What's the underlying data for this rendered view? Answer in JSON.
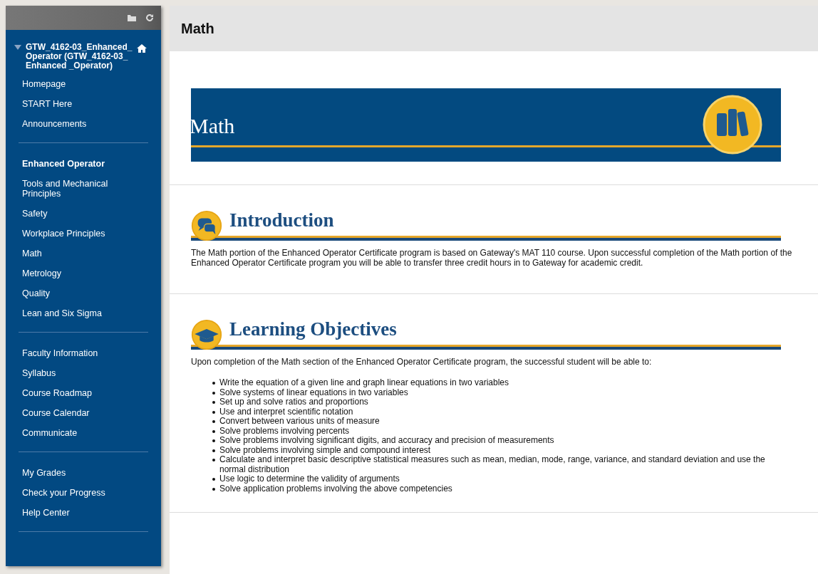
{
  "sidebar": {
    "course": {
      "title": "GTW_4162-03_Enhanced_Operator (GTW_4162-03_Enhanced _Operator)",
      "expanded": true
    },
    "groups": [
      {
        "items": [
          {
            "label": "Homepage",
            "kind": "link"
          },
          {
            "label": "START Here",
            "kind": "link"
          },
          {
            "label": "Announcements",
            "kind": "link"
          }
        ]
      },
      {
        "items": [
          {
            "label": "Enhanced Operator",
            "kind": "heading"
          },
          {
            "label": "Tools and Mechanical Principles",
            "kind": "link"
          },
          {
            "label": "Safety",
            "kind": "link"
          },
          {
            "label": "Workplace Principles",
            "kind": "link"
          },
          {
            "label": "Math",
            "kind": "link"
          },
          {
            "label": "Metrology",
            "kind": "link"
          },
          {
            "label": "Quality",
            "kind": "link"
          },
          {
            "label": "Lean and Six Sigma",
            "kind": "link"
          }
        ]
      },
      {
        "items": [
          {
            "label": "Faculty Information",
            "kind": "link"
          },
          {
            "label": "Syllabus",
            "kind": "link"
          },
          {
            "label": "Course Roadmap",
            "kind": "link"
          },
          {
            "label": "Course Calendar",
            "kind": "link"
          },
          {
            "label": "Communicate",
            "kind": "link"
          }
        ]
      },
      {
        "items": [
          {
            "label": "My Grades",
            "kind": "link"
          },
          {
            "label": "Check your Progress",
            "kind": "link"
          },
          {
            "label": "Help Center",
            "kind": "link"
          }
        ]
      }
    ]
  },
  "page": {
    "title": "Math",
    "banner": {
      "title": "Math"
    },
    "sections": [
      {
        "heading": "Introduction",
        "intro": "The Math portion of the Enhanced Operator Certificate program is based on Gateway's MAT 110 course. Upon successful completion of the Math portion of the Enhanced Operator Certificate program you will be able to transfer three credit hours in to Gateway for academic credit."
      },
      {
        "heading": "Learning Objectives",
        "intro": "Upon completion of the Math section of the Enhanced Operator Certificate program, the successful student will be able to:",
        "bullets": [
          "Write the equation of a given line and graph linear equations in two variables",
          "Solve systems of linear equations in two variables",
          "Set up and solve ratios and proportions",
          "Use and interpret scientific notation",
          "Convert between various units of measure",
          "Solve problems involving percents",
          "Solve problems involving significant digits, and accuracy and precision of measurements",
          "Solve problems involving simple and compound interest",
          "Calculate and interpret basic descriptive statistical measures such as mean, median, mode, range, variance, and standard deviation and use the normal distribution",
          "Use logic to determine the validity of arguments",
          "Solve application problems involving the above competencies"
        ]
      }
    ]
  }
}
